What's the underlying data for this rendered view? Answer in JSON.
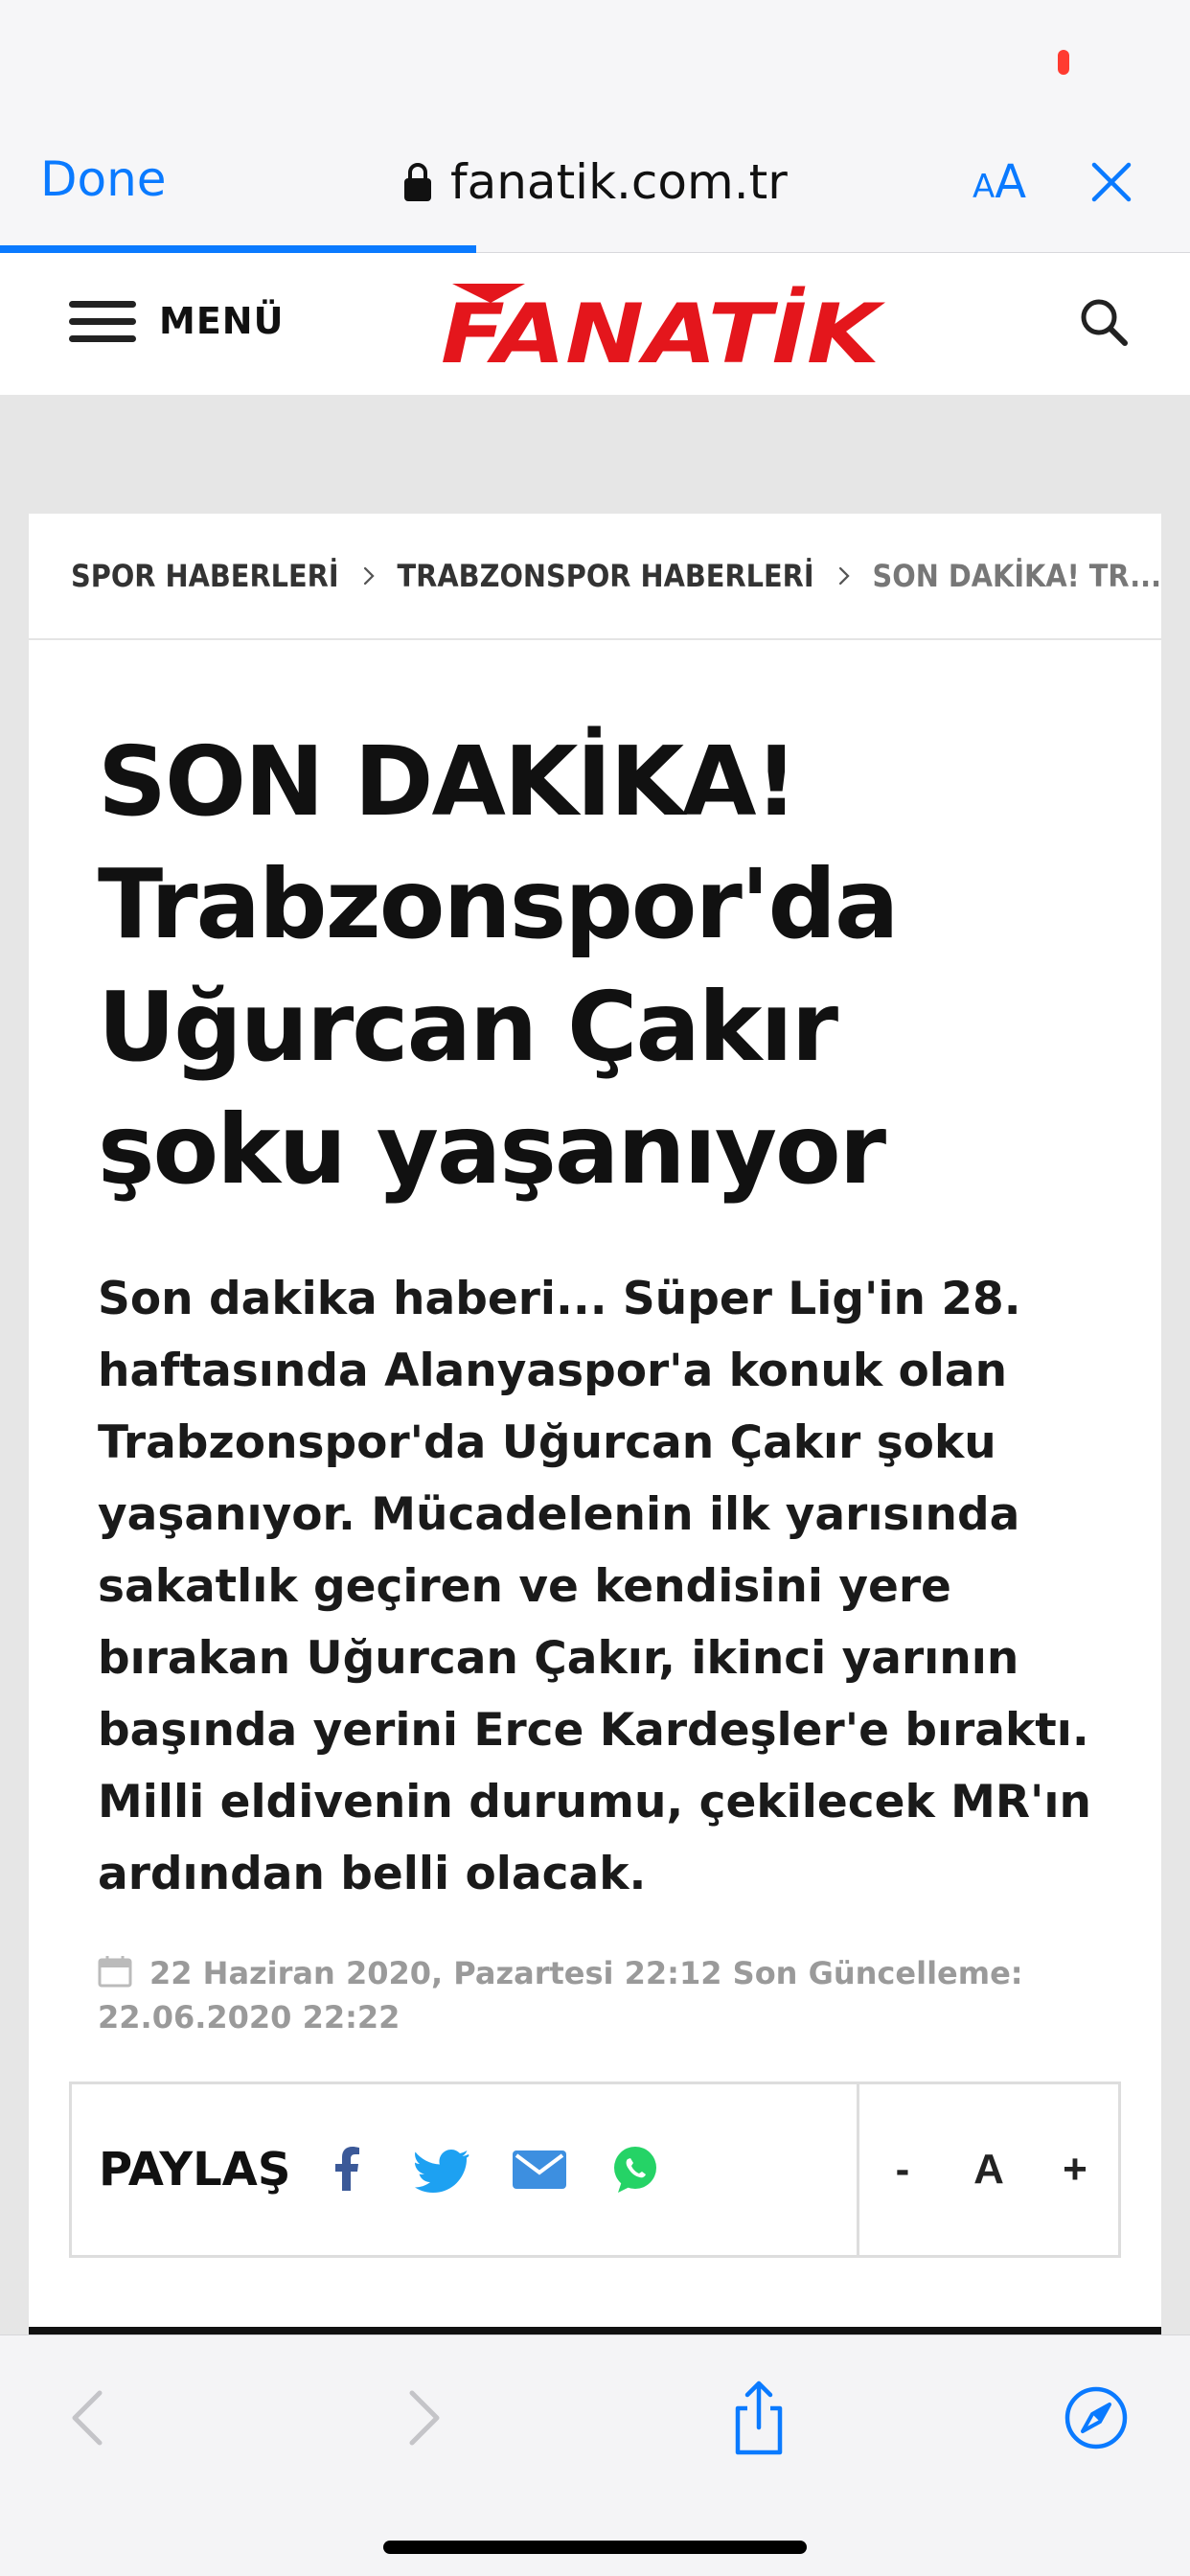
{
  "browser": {
    "done_label": "Done",
    "url": "fanatik.com.tr",
    "text_size_small": "A",
    "text_size_big": "A",
    "accent_color": "#0a7aff",
    "load_progress": 0.4
  },
  "site_header": {
    "menu_label": "MENÜ",
    "logo_text": "FANATİK",
    "logo_color": "#e4161c"
  },
  "breadcrumb": [
    {
      "label": "SPOR HABERLERİ"
    },
    {
      "label": "TRABZONSPOR HABERLERİ"
    },
    {
      "label": "SON DAKİKA! TR..."
    }
  ],
  "article": {
    "headline": "SON DAKİKA! Trabzonspor'da Uğurcan Çakır şoku yaşanıyor",
    "spot": "Son dakika haberi... Süper Lig'in 28. haftasında Alanyaspor'a konuk olan Trabzonspor'da Uğurcan Çakır şoku yaşanıyor. Mücadelenin ilk yarısında sakatlık geçiren ve kendisini yere bırakan Uğurcan Çakır, ikinci yarının başında yerini Erce Kardeşler'e bıraktı. Milli eldivenin durumu, çekilecek MR'ın ardından belli olacak.",
    "dateline": "22 Haziran 2020, Pazartesi 22:12 Son Güncelleme: 22.06.2020 22:22"
  },
  "share": {
    "label": "PAYLAŞ",
    "icons": [
      "facebook-icon",
      "twitter-icon",
      "mail-icon",
      "whatsapp-icon"
    ],
    "font_decrease": "-",
    "font_label": "A",
    "font_increase": "+"
  },
  "toolbar": {
    "icons": [
      "back-icon",
      "forward-icon",
      "share-icon",
      "compass-icon"
    ]
  }
}
